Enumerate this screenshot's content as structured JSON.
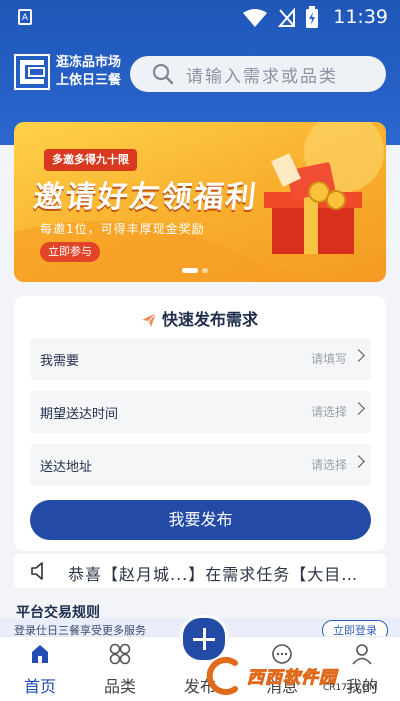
{
  "status_bar": {
    "time": "11:39",
    "left_icon": "A"
  },
  "header": {
    "logo_line1": "逛冻品市场",
    "logo_line2": "上依日三餐",
    "search_placeholder": "请输入需求或品类"
  },
  "banner": {
    "pill": "多邀多得九十限",
    "headline": "邀请好友领福利",
    "subtitle": "每邀1位，可得丰厚现金奖励",
    "cta": "立即参与",
    "active_slide": 1,
    "slide_count": 2
  },
  "quick_publish": {
    "title": "快速发布需求",
    "fields": [
      {
        "label": "我需要",
        "placeholder": "请填写"
      },
      {
        "label": "期望送达时间",
        "placeholder": "请选择"
      },
      {
        "label": "送达地址",
        "placeholder": "请选择"
      }
    ],
    "submit": "我要发布"
  },
  "ticker": {
    "text": "恭喜【赵月城...】在需求任务【大目…"
  },
  "section_peek": {
    "title": "平台交易规则"
  },
  "login_strip": {
    "text": "登录仕日三餐享受更多服务",
    "button": "立即登录"
  },
  "bottom_nav": {
    "items": [
      {
        "label": "首页",
        "icon": "home-icon",
        "active": true
      },
      {
        "label": "品类",
        "icon": "grid-icon",
        "active": false
      },
      {
        "label": "发布",
        "icon": "plus-icon",
        "active": false
      },
      {
        "label": "消息",
        "icon": "message-icon",
        "active": false
      },
      {
        "label": "我的",
        "icon": "user-icon",
        "active": false
      }
    ]
  },
  "watermark": {
    "text": "西西软件园",
    "url": "CR173.COM"
  },
  "colors": {
    "primary": "#234aa5",
    "header_blue": "#2b67cf",
    "banner_orange": "#f8ae2c"
  }
}
